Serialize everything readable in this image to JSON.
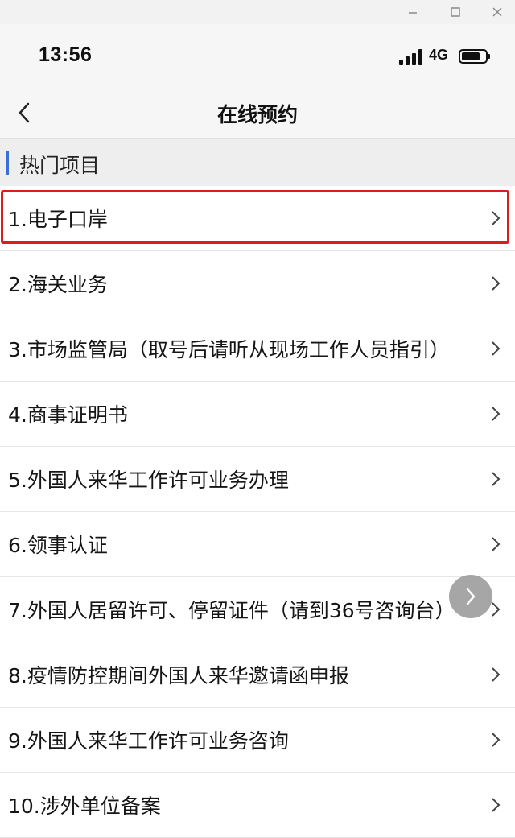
{
  "window": {
    "minimize_icon": "minimize-icon",
    "maximize_icon": "maximize-icon",
    "close_icon": "close-icon"
  },
  "status_bar": {
    "time": "13:56",
    "network": "4G",
    "signal_icon": "signal-bars-icon",
    "battery_icon": "battery-icon"
  },
  "nav": {
    "title": "在线预约",
    "back_icon": "chevron-left-icon"
  },
  "section": {
    "title": "热门项目"
  },
  "list": {
    "items": [
      {
        "label": "1.电子口岸"
      },
      {
        "label": "2.海关业务"
      },
      {
        "label": "3.市场监管局（取号后请听从现场工作人员指引）"
      },
      {
        "label": "4.商事证明书"
      },
      {
        "label": "5.外国人来华工作许可业务办理"
      },
      {
        "label": "6.领事认证"
      },
      {
        "label": "7.外国人居留许可、停留证件（请到36号咨询台）"
      },
      {
        "label": "8.疫情防控期间外国人来华邀请函申报"
      },
      {
        "label": "9.外国人来华工作许可业务咨询"
      },
      {
        "label": "10.涉外单位备案"
      }
    ],
    "highlighted_index": 0
  },
  "colors": {
    "accent_bar": "#3a6fd8",
    "highlight_border": "#e11b1b"
  },
  "floating_button": {
    "icon": "chevron-right-icon"
  }
}
